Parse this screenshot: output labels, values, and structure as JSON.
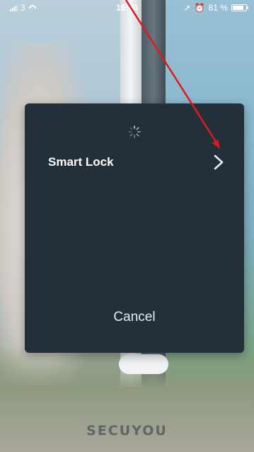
{
  "status_bar": {
    "carrier": "3",
    "time": "16:06",
    "battery": "81 %",
    "battery_level": 0.81
  },
  "modal": {
    "item_label": "Smart Lock",
    "cancel_label": "Cancel"
  },
  "brand": {
    "text": "SECUYOU"
  },
  "colors": {
    "modal_bg": "#23303a",
    "annotation_arrow": "#e0191f"
  }
}
